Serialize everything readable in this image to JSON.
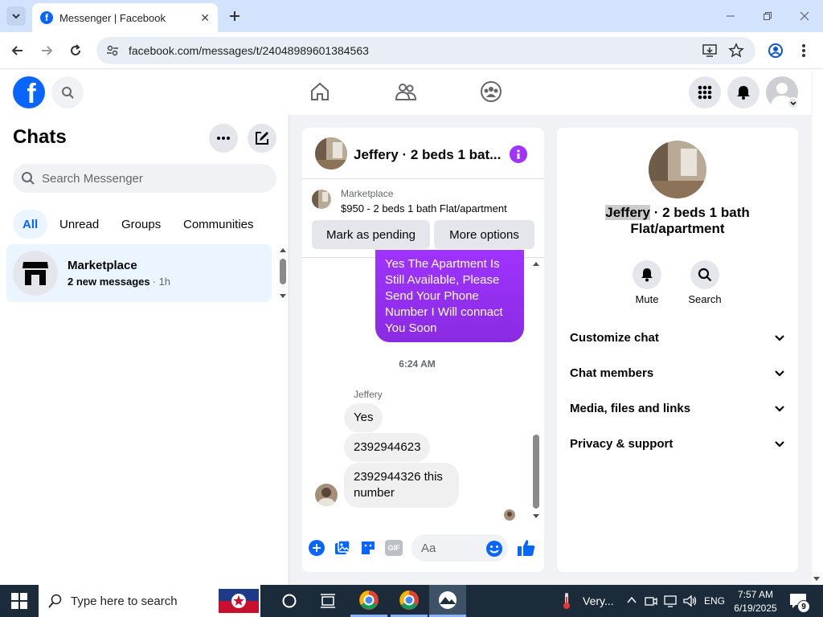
{
  "browser": {
    "tab_title": "Messenger | Facebook",
    "url": "facebook.com/messages/t/24048989601384563"
  },
  "fb_header": {
    "logo_letter": "f"
  },
  "chats": {
    "title": "Chats",
    "search_placeholder": "Search Messenger",
    "filters": [
      "All",
      "Unread",
      "Groups",
      "Communities"
    ],
    "active_filter": "All",
    "threads": [
      {
        "name": "Marketplace",
        "preview": "2 new messages",
        "time": "· 1h"
      }
    ]
  },
  "conversation": {
    "title": "Jeffery · 2 beds 1 bat...",
    "listing_source": "Marketplace",
    "listing_title": "$950 - 2 beds 1 bath Flat/apartment",
    "mark_pending_label": "Mark as pending",
    "more_options_label": "More options",
    "outgoing_message": "Yes The Apartment Is Still Available, Please Send Your Phone Number I Will connact You Soon",
    "timestamp": "6:24 AM",
    "sender_name": "Jeffery",
    "incoming_messages": [
      "Yes",
      "2392944623",
      "2392944326 this number"
    ],
    "composer_placeholder": "Aa"
  },
  "info_panel": {
    "name_highlight": "Jeffery",
    "name_rest": " · 2 beds 1 bath",
    "name_line2": "Flat/apartment",
    "mute_label": "Mute",
    "search_label": "Search",
    "sections": [
      "Customize chat",
      "Chat members",
      "Media, files and links",
      "Privacy & support"
    ]
  },
  "taskbar": {
    "search_placeholder": "Type here to search",
    "weather": "Very...",
    "language": "ENG",
    "time": "7:57 AM",
    "date": "6/19/2025",
    "notification_count": "9"
  },
  "colors": {
    "accent": "#0866ff",
    "bubble_out_start": "#a033ff",
    "bubble_out_end": "#8a2be2",
    "taskbar": "#1c2b3a"
  }
}
